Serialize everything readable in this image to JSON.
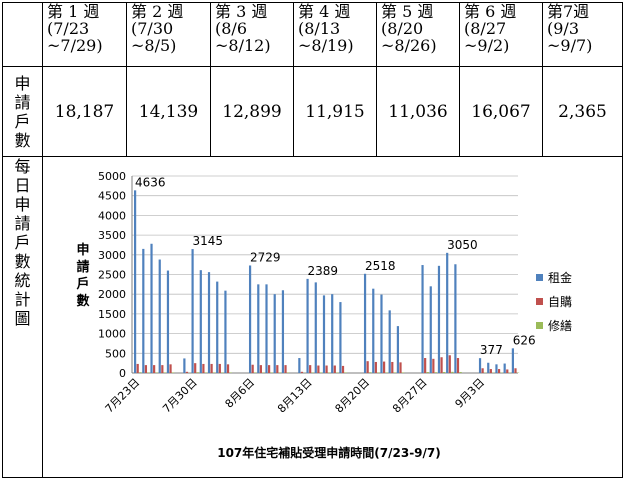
{
  "table": {
    "week_headers": [
      [
        "第 1 週",
        "(7/23",
        "~7/29)"
      ],
      [
        "第 2 週",
        "(7/30",
        "~8/5)"
      ],
      [
        "第 3 週",
        "(8/6",
        "~8/12)"
      ],
      [
        "第 4 週",
        "(8/13",
        "~8/19)"
      ],
      [
        "第 5 週",
        "(8/20",
        "~8/26)"
      ],
      [
        "第 6 週",
        "(8/27",
        "~9/2)"
      ],
      [
        "第7週",
        "(9/3",
        "~9/7)"
      ]
    ],
    "row1_label_chars": [
      "申",
      "請",
      "戶",
      "數"
    ],
    "row1_values": [
      "18,187",
      "14,139",
      "12,899",
      "11,915",
      "11,036",
      "16,067",
      "2,365"
    ],
    "row2_label_chars": [
      "每",
      "日",
      "申",
      "請",
      "戶",
      "數",
      "統",
      "計",
      "圖"
    ]
  },
  "chart_data": {
    "type": "bar",
    "xlabel": "107年住宅補貼受理申請時間(7/23-9/7)",
    "ylabel_chars": [
      "申",
      "請",
      "戶",
      "數"
    ],
    "ylim": [
      0,
      5000
    ],
    "yticks": [
      0,
      500,
      1000,
      1500,
      2000,
      2500,
      3000,
      3500,
      4000,
      4500,
      5000
    ],
    "x_tick_labels": [
      "7月23日",
      "7月30日",
      "8月6日",
      "8月13日",
      "8月20日",
      "8月27日",
      "9月3日"
    ],
    "grid": true,
    "legend_position": "right",
    "colors": {
      "rent": "#4f81bd",
      "buy": "#c0504d",
      "repair": "#9bbb59"
    },
    "categories": [
      "7/23",
      "7/24",
      "7/25",
      "7/26",
      "7/27",
      "7/28",
      "7/29",
      "7/30",
      "7/31",
      "8/1",
      "8/2",
      "8/3",
      "8/4",
      "8/5",
      "8/6",
      "8/7",
      "8/8",
      "8/9",
      "8/10",
      "8/11",
      "8/12",
      "8/13",
      "8/14",
      "8/15",
      "8/16",
      "8/17",
      "8/18",
      "8/19",
      "8/20",
      "8/21",
      "8/22",
      "8/23",
      "8/24",
      "8/25",
      "8/26",
      "8/27",
      "8/28",
      "8/29",
      "8/30",
      "8/31",
      "9/1",
      "9/2",
      "9/3",
      "9/4",
      "9/5",
      "9/6",
      "9/7"
    ],
    "series": [
      {
        "name": "租金",
        "color_key": "rent",
        "values": [
          4636,
          3150,
          3280,
          2880,
          2600,
          0,
          370,
          3145,
          2610,
          2560,
          2320,
          2090,
          0,
          0,
          2729,
          2250,
          2250,
          2000,
          2100,
          0,
          380,
          2389,
          2300,
          1970,
          2000,
          1800,
          0,
          0,
          2518,
          2140,
          1990,
          1590,
          1190,
          0,
          0,
          2740,
          2200,
          2720,
          3050,
          2760,
          0,
          0,
          377,
          260,
          220,
          240,
          626
        ]
      },
      {
        "name": "自購",
        "color_key": "buy",
        "values": [
          230,
          200,
          200,
          200,
          220,
          0,
          30,
          250,
          230,
          230,
          230,
          220,
          0,
          0,
          210,
          200,
          200,
          200,
          200,
          0,
          30,
          200,
          190,
          190,
          190,
          180,
          0,
          0,
          300,
          280,
          290,
          280,
          270,
          0,
          0,
          380,
          360,
          400,
          450,
          380,
          0,
          0,
          120,
          100,
          100,
          90,
          120
        ]
      },
      {
        "name": "修繕",
        "color_key": "repair",
        "values": [
          20,
          15,
          15,
          15,
          15,
          0,
          5,
          20,
          15,
          15,
          15,
          15,
          0,
          0,
          15,
          15,
          15,
          15,
          15,
          0,
          5,
          15,
          15,
          15,
          15,
          15,
          0,
          0,
          20,
          15,
          15,
          15,
          15,
          0,
          0,
          25,
          20,
          25,
          30,
          25,
          0,
          0,
          10,
          10,
          10,
          10,
          10
        ]
      }
    ],
    "data_labels": [
      {
        "category": "7/23",
        "text": "4636"
      },
      {
        "category": "7/30",
        "text": "3145"
      },
      {
        "category": "8/6",
        "text": "2729"
      },
      {
        "category": "8/13",
        "text": "2389"
      },
      {
        "category": "8/20",
        "text": "2518"
      },
      {
        "category": "8/30",
        "text": "3050"
      },
      {
        "category": "9/3",
        "text": "377"
      },
      {
        "category": "9/7",
        "text": "626"
      }
    ]
  }
}
